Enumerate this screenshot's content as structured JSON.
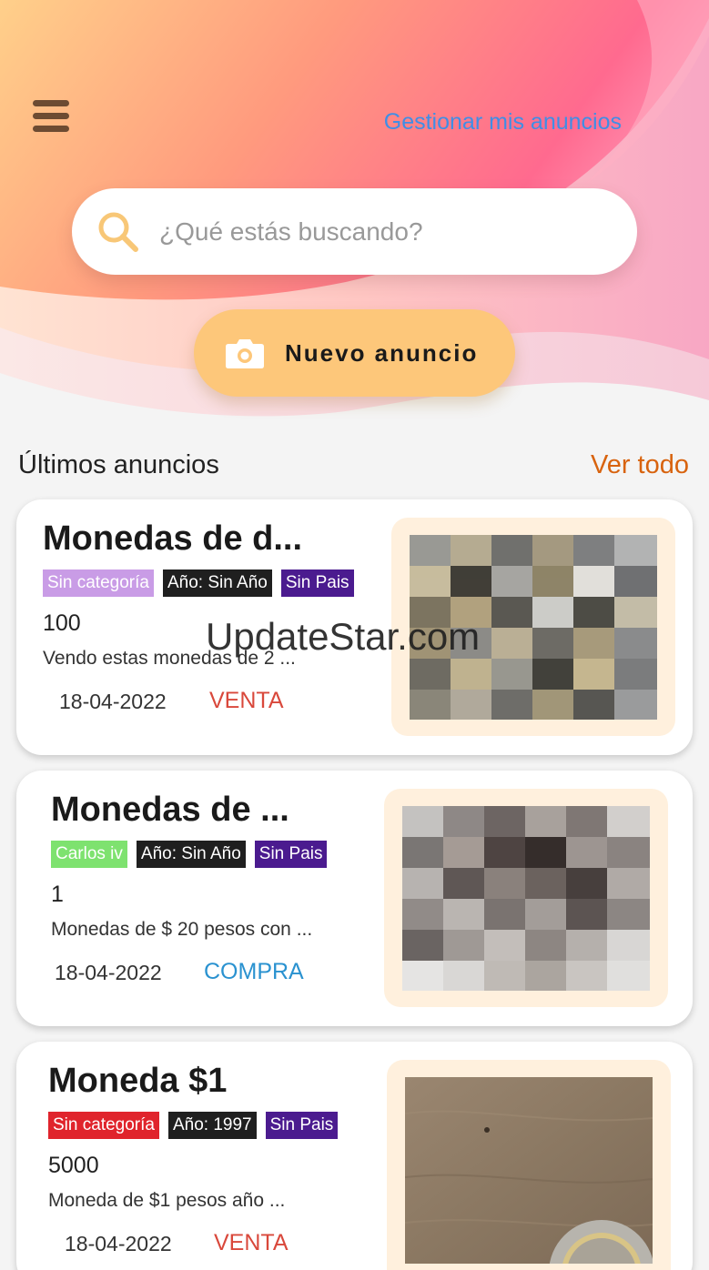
{
  "header": {
    "manage_link": "Gestionar mis anuncios",
    "menu_icon": "hamburger-menu-icon"
  },
  "search": {
    "placeholder": "¿Qué estás buscando?",
    "icon": "search-icon"
  },
  "new_ad": {
    "label": "Nuevo anuncio",
    "icon": "camera-icon"
  },
  "section": {
    "title": "Últimos anuncios",
    "see_all": "Ver todo"
  },
  "listings": [
    {
      "title": "Monedas de d...",
      "tags": [
        {
          "label": "Sin categoría",
          "color": "#c99ce6"
        },
        {
          "label": "Año: Sin Año",
          "color": "#1f1f1f"
        },
        {
          "label": "Sin Pais",
          "color": "#4b1b8f"
        }
      ],
      "price": "100",
      "description": "Vendo estas monedas de 2 ...",
      "date": "18-04-2022",
      "type": "VENTA",
      "type_color": "#d9483b"
    },
    {
      "title": "Monedas de ...",
      "tags": [
        {
          "label": "Carlos iv",
          "color": "#7ee26f"
        },
        {
          "label": "Año: Sin Año",
          "color": "#1f1f1f"
        },
        {
          "label": "Sin Pais",
          "color": "#4b1b8f"
        }
      ],
      "price": "1",
      "description": "Monedas de $ 20 pesos con ...",
      "date": "18-04-2022",
      "type": "COMPRA",
      "type_color": "#2a92d0"
    },
    {
      "title": "Moneda $1",
      "tags": [
        {
          "label": "Sin categoría",
          "color": "#e0242c"
        },
        {
          "label": "Año: 1997",
          "color": "#1f1f1f"
        },
        {
          "label": "Sin Pais",
          "color": "#4b1b8f"
        }
      ],
      "price": "5000",
      "description": "Moneda de $1 pesos año ...",
      "date": "18-04-2022",
      "type": "VENTA",
      "type_color": "#d9483b"
    }
  ],
  "watermark": "UpdateStar.com",
  "colors": {
    "accent_orange": "#fdc77a",
    "link_blue": "#3f8ee6",
    "see_all_orange": "#d8630e"
  }
}
